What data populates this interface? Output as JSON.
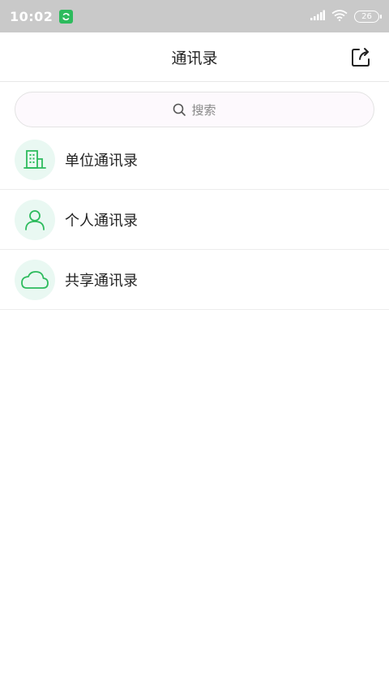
{
  "status_bar": {
    "time": "10:02",
    "battery": "26"
  },
  "header": {
    "title": "通讯录"
  },
  "search": {
    "placeholder": "搜索"
  },
  "list": {
    "items": [
      {
        "label": "单位通讯录",
        "icon": "building-icon"
      },
      {
        "label": "个人通讯录",
        "icon": "person-icon"
      },
      {
        "label": "共享通讯录",
        "icon": "cloud-icon"
      }
    ]
  },
  "colors": {
    "accent": "#2dbb5d",
    "icon_bg": "#e9f8f2",
    "status_bar_bg": "#c9c9c9"
  }
}
